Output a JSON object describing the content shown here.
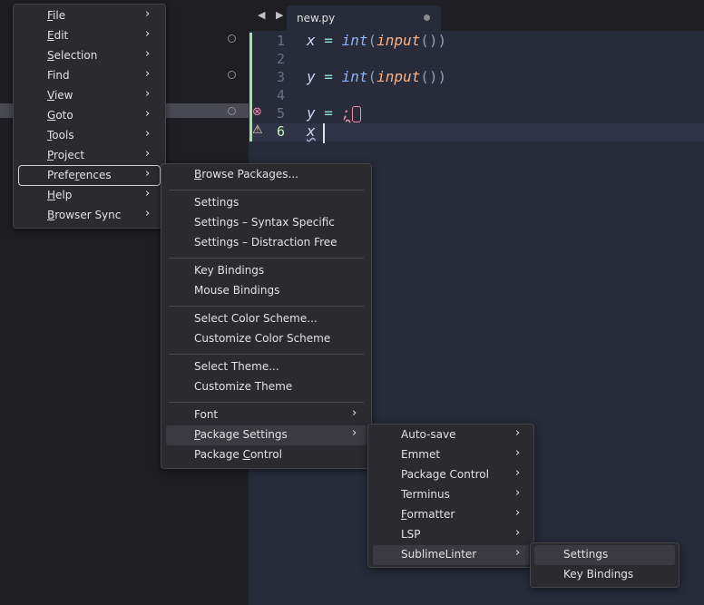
{
  "tab": {
    "filename": "new.py",
    "nav": "◀ ▶"
  },
  "editor": {
    "lines": [
      {
        "num": "1",
        "text": "x = int(input())"
      },
      {
        "num": "2",
        "text": ""
      },
      {
        "num": "3",
        "text": "y = int(input())"
      },
      {
        "num": "4",
        "text": ""
      },
      {
        "num": "5",
        "text": "y = ;"
      },
      {
        "num": "6",
        "text": "x"
      }
    ]
  },
  "main_menu": {
    "items": [
      {
        "label": "File",
        "mn": "F",
        "rest": "ile"
      },
      {
        "label": "Edit",
        "mn": "E",
        "rest": "dit"
      },
      {
        "label": "Selection",
        "mn": "S",
        "rest": "election"
      },
      {
        "label": "Find",
        "mn": "F",
        "rest": "ind"
      },
      {
        "label": "View",
        "mn": "V",
        "rest": "iew"
      },
      {
        "label": "Goto",
        "mn": "G",
        "rest": "oto"
      },
      {
        "label": "Tools",
        "mn": "T",
        "rest": "ools"
      },
      {
        "label": "Project",
        "mn": "P",
        "rest": "roject"
      },
      {
        "label": "Preferences",
        "pre": "Prefe",
        "mn": "r",
        "rest": "ences"
      },
      {
        "label": "Help",
        "mn": "H",
        "rest": "elp"
      },
      {
        "label": "Browser Sync",
        "mn": "B",
        "rest": "rowser Sync"
      }
    ]
  },
  "preferences_menu": {
    "items": [
      {
        "label": "Browse Packages...",
        "mn": "B",
        "rest": "rowse Packages..."
      },
      {
        "label": "Settings"
      },
      {
        "label": "Settings – Syntax Specific"
      },
      {
        "label": "Settings – Distraction Free"
      },
      {
        "label": "Key Bindings"
      },
      {
        "label": "Mouse Bindings"
      },
      {
        "label": "Select Color Scheme..."
      },
      {
        "label": "Customize Color Scheme"
      },
      {
        "label": "Select Theme..."
      },
      {
        "label": "Customize Theme"
      },
      {
        "label": "Font"
      },
      {
        "label": "Package Settings",
        "mn": "P",
        "rest": "ackage Settings"
      },
      {
        "label": "Package Control",
        "pre": "Package ",
        "mn": "C",
        "rest": "ontrol"
      }
    ]
  },
  "package_settings_menu": {
    "items": [
      {
        "label": "Auto-save"
      },
      {
        "label": "Emmet"
      },
      {
        "label": "Package Control"
      },
      {
        "label": "Terminus"
      },
      {
        "label": "Formatter",
        "mn": "F",
        "rest": "ormatter"
      },
      {
        "label": "LSP"
      },
      {
        "label": "SublimeLinter"
      }
    ]
  },
  "sublimelinter_menu": {
    "items": [
      {
        "label": "Settings"
      },
      {
        "label": "Key Bindings"
      }
    ]
  },
  "icons": {
    "submenu_arrow": "›",
    "error": "⊗",
    "warning": "⚠"
  }
}
